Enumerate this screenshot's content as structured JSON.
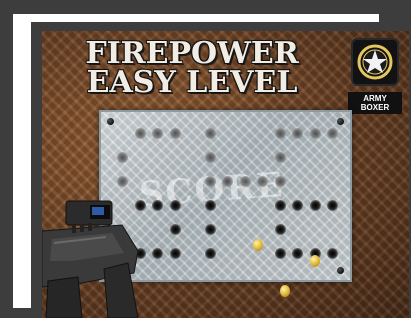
{
  "game": {
    "title_line1": "FIREPOWER",
    "title_line2": "EASY LEVEL",
    "brand_label": "ARMY BOXER",
    "score_watermark": "SCORE"
  },
  "icons": {
    "brand": "star-badge-icon",
    "weapon": "rifle-icon",
    "casings": "bullet-casing-icon"
  },
  "colors": {
    "title_text": "#f1ede4",
    "backdrop": "#6e4325",
    "plate": "#c7ced1",
    "casing": "#e2b93a"
  },
  "board": {
    "shot_pattern_cells": [
      "0111010001111",
      "1000010001000",
      "1000011111000",
      "0111010001111",
      "0001010001000",
      "1111010001111"
    ]
  }
}
